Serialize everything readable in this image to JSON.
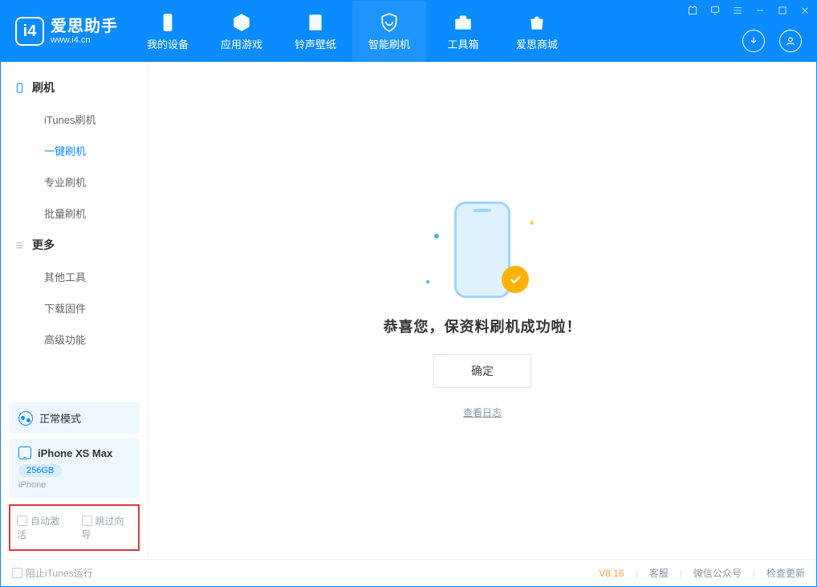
{
  "app": {
    "title": "爱思助手",
    "subtitle": "www.i4.cn"
  },
  "nav": {
    "device": "我的设备",
    "apps": "应用游戏",
    "media": "铃声壁纸",
    "flash": "智能刷机",
    "tools": "工具箱",
    "store": "爱思商城"
  },
  "sidebar": {
    "section_flash": "刷机",
    "items_flash": {
      "itunes": "iTunes刷机",
      "oneclick": "一键刷机",
      "pro": "专业刷机",
      "batch": "批量刷机"
    },
    "section_more": "更多",
    "items_more": {
      "other": "其他工具",
      "firmware": "下载固件",
      "advanced": "高级功能"
    },
    "mode_label": "正常模式",
    "device_name": "iPhone XS Max",
    "device_capacity": "256GB",
    "device_type": "iPhone",
    "chk_auto_activate": "自动激活",
    "chk_skip_guide": "跳过向导"
  },
  "main": {
    "success_text": "恭喜您，保资料刷机成功啦！",
    "ok_button": "确定",
    "log_link": "查看日志"
  },
  "footer": {
    "block_itunes": "阻止iTunes运行",
    "version": "V8.16",
    "support": "客服",
    "wechat": "微信公众号",
    "update": "检查更新"
  }
}
